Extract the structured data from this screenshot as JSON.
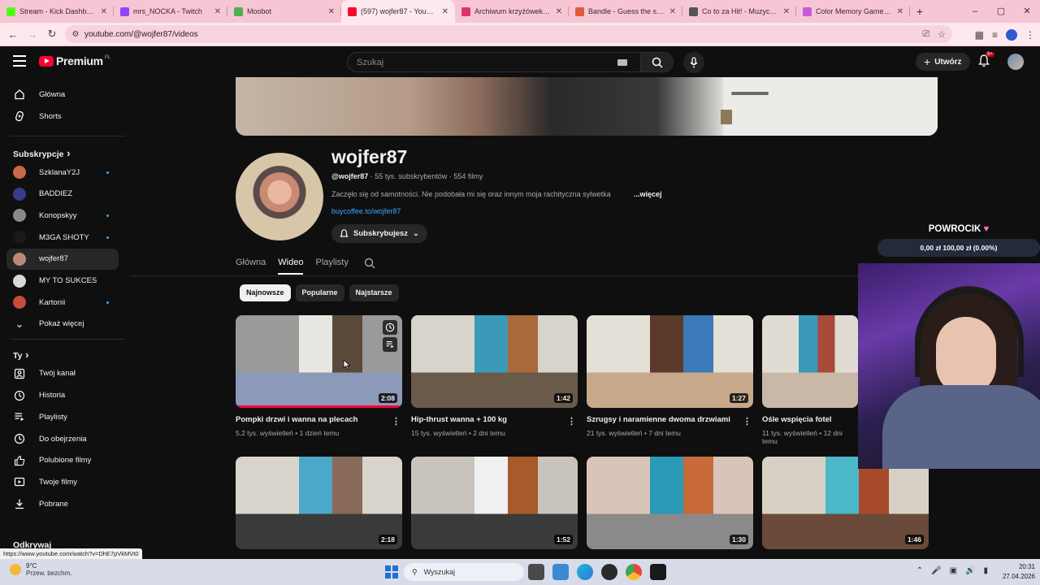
{
  "browser": {
    "tabs": [
      {
        "title": "Stream - Kick Dashboard",
        "fav_color": "#53fc18",
        "active": false
      },
      {
        "title": "mrs_NOCKA - Twitch",
        "fav_color": "#9146ff",
        "active": false
      },
      {
        "title": "Moobot",
        "fav_color": "#4caf50",
        "active": false
      },
      {
        "title": "(597) wojfer87 - YouTube",
        "fav_color": "#ff0033",
        "active": true
      },
      {
        "title": "Archiwum krzyżówek muz",
        "fav_color": "#e0306a",
        "active": false
      },
      {
        "title": "Bandle - Guess the song",
        "fav_color": "#e05a3a",
        "active": false
      },
      {
        "title": "Co to za Hit! - Muzyczny",
        "fav_color": "#555555",
        "active": false
      },
      {
        "title": "Color Memory Game — h",
        "fav_color": "#c85ad8",
        "active": false
      }
    ],
    "url": "youtube.com/@wojfer87/videos",
    "status_url": "https://www.youtube.com/watch?v=DhE7pVkMVt0"
  },
  "yt_header": {
    "logo_text": "Premium",
    "country": "PL",
    "search_placeholder": "Szukaj",
    "create_label": "Utwórz",
    "notif_badge": "9+"
  },
  "sidebar": {
    "main": [
      {
        "label": "Główna",
        "icon": "home-icon"
      },
      {
        "label": "Shorts",
        "icon": "shorts-icon"
      }
    ],
    "subs_header": "Subskrypcje",
    "subs": [
      {
        "label": "SzklanaY2J",
        "color": "#c86a4a",
        "dot": true,
        "selected": false
      },
      {
        "label": "BADDIEZ",
        "color": "#3a3a8a",
        "dot": false,
        "selected": false
      },
      {
        "label": "Konopskyy",
        "color": "#8a8a8a",
        "dot": true,
        "selected": false
      },
      {
        "label": "M3GA SHOTY",
        "color": "#1a1a1a",
        "dot": true,
        "selected": false
      },
      {
        "label": "wojfer87",
        "color": "#b88a7a",
        "dot": false,
        "selected": true
      },
      {
        "label": "MY TO SUKCES",
        "color": "#d8d8d8",
        "dot": false,
        "selected": false
      },
      {
        "label": "Kartonii",
        "color": "#c84a3a",
        "dot": true,
        "selected": false
      }
    ],
    "show_more": "Pokaż więcej",
    "you_header": "Ty",
    "you": [
      {
        "label": "Twój kanał",
        "icon": "channel-icon"
      },
      {
        "label": "Historia",
        "icon": "history-icon"
      },
      {
        "label": "Playlisty",
        "icon": "playlist-icon"
      },
      {
        "label": "Do obejrzenia",
        "icon": "watch-later-icon"
      },
      {
        "label": "Polubione filmy",
        "icon": "like-icon"
      },
      {
        "label": "Twoje filmy",
        "icon": "your-videos-icon"
      },
      {
        "label": "Pobrane",
        "icon": "download-icon"
      }
    ],
    "explore_header": "Odkrywaj"
  },
  "channel": {
    "name": "wojfer87",
    "handle": "@wojfer87",
    "meta": " · 55 tys. subskrybentów · 554 filmy",
    "description": "Zaczęło się od samotności. Nie podobała mi się oraz innym moja rachityczna sylwetka",
    "more_label": "...więcej",
    "link": "buycoffee.to/wojfer87",
    "subscribe_label": "Subskrybujesz",
    "tabs": [
      "Główna",
      "Wideo",
      "Playlisty"
    ],
    "active_tab": 1,
    "chips": [
      "Najnowsze",
      "Popularne",
      "Najstarsze"
    ],
    "active_chip": 0
  },
  "videos": [
    {
      "title": "Pompki drzwi i wanna na plecach",
      "views": "5,2 tys. wyświetleń",
      "age": "1 dzień temu",
      "duration": "2:08",
      "progress": 1.0,
      "colors": [
        "#9a9a98",
        "#e8e6e0",
        "#5a4a3a",
        "#8a9ab8"
      ]
    },
    {
      "title": "Hip-thrust wanna + 100 kg",
      "views": "15 tys. wyświetleń",
      "age": "2 dni temu",
      "duration": "1:42",
      "progress": 0.0,
      "colors": [
        "#d8d4cc",
        "#3a9ab8",
        "#a86a3a",
        "#6a5a4a"
      ]
    },
    {
      "title": "Szrugsy i naramienne dwoma drzwiami",
      "views": "21 tys. wyświetleń",
      "age": "7 dni temu",
      "duration": "1:27",
      "progress": 0.0,
      "colors": [
        "#e4e0d8",
        "#5a3a2a",
        "#3a7ab8",
        "#c8a88a"
      ]
    },
    {
      "title": "Ośle wspięcia fotel",
      "views": "11 tys. wyświetleń",
      "age": "12 dni temu",
      "duration": "",
      "progress": 0.0,
      "colors": [
        "#e0dcd4",
        "#3a9ab8",
        "#a84a3a",
        "#c8b8a8"
      ]
    },
    {
      "title": "",
      "views": "",
      "age": "",
      "duration": "2:18",
      "progress": 0.0,
      "colors": [
        "#d8d4cc",
        "#4aa8c8",
        "#8a6a5a",
        "#3a3a3a"
      ]
    },
    {
      "title": "",
      "views": "",
      "age": "",
      "duration": "1:52",
      "progress": 0.0,
      "colors": [
        "#c8c4bc",
        "#f0f0f0",
        "#a85a2a",
        "#3a3a3a"
      ]
    },
    {
      "title": "",
      "views": "",
      "age": "",
      "duration": "1:30",
      "progress": 0.0,
      "colors": [
        "#d8c4b8",
        "#2a9ab8",
        "#c86a3a",
        "#8a8a8a"
      ]
    },
    {
      "title": "",
      "views": "",
      "age": "",
      "duration": "1:46",
      "progress": 0.0,
      "colors": [
        "#d8d0c4",
        "#4ab8c8",
        "#a84a2a",
        "#6a4a3a"
      ]
    }
  ],
  "overlay": {
    "title": "POWROCIK",
    "bar": "0,00 zł   100,00 zł (0.00%)"
  },
  "taskbar": {
    "temp": "9°C",
    "weather": "Przew. bezchm.",
    "search": "Wyszukaj",
    "time": "20:31",
    "date": "27.04.2026"
  }
}
